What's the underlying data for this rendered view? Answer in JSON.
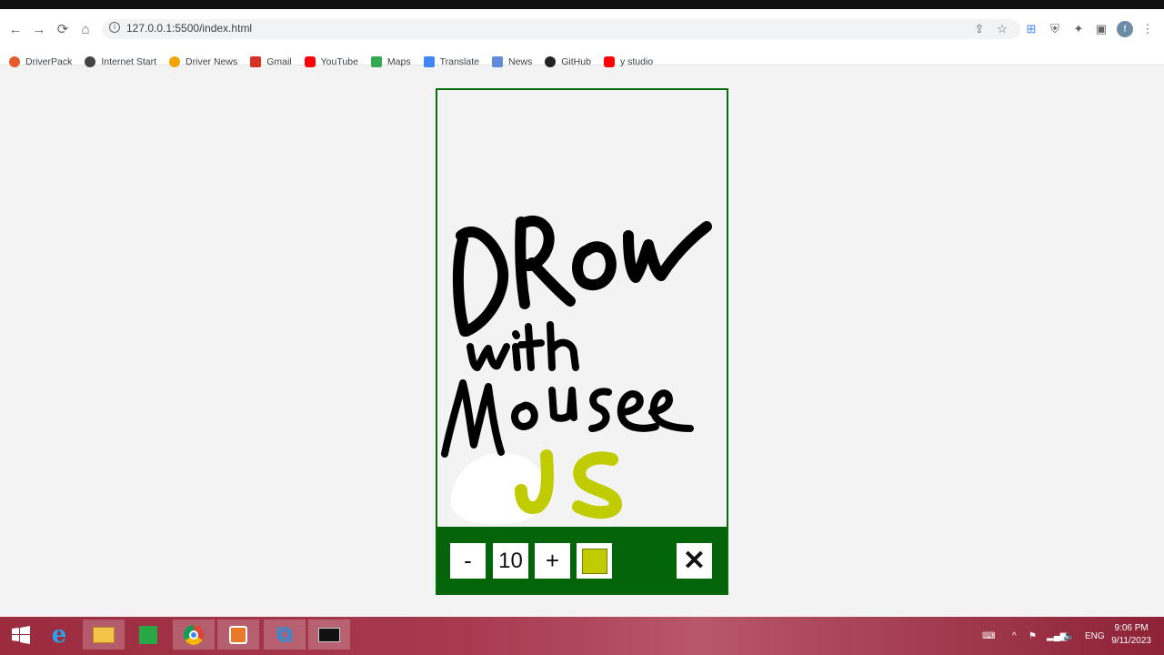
{
  "browser": {
    "url": "127.0.0.1:5500/index.html",
    "profile_initial": "f",
    "bookmarks": [
      {
        "label": "DriverPack",
        "color": "#e35b2c"
      },
      {
        "label": "Internet Start",
        "color": "#444444"
      },
      {
        "label": "Driver News",
        "color": "#f0a500"
      },
      {
        "label": "Gmail",
        "color": "#d93025"
      },
      {
        "label": "YouTube",
        "color": "#ff0000"
      },
      {
        "label": "Maps",
        "color": "#34a853"
      },
      {
        "label": "Translate",
        "color": "#4285f4"
      },
      {
        "label": "News",
        "color": "#5f8bd8"
      },
      {
        "label": "GitHub",
        "color": "#222222"
      },
      {
        "label": "y studio",
        "color": "#ff0000"
      }
    ]
  },
  "app": {
    "brush_size": "10",
    "decrease_label": "-",
    "increase_label": "+",
    "clear_label": "✕",
    "brush_color": "#c1cc00",
    "toolbar_color": "#036409",
    "border_color": "#0a6b0a"
  },
  "taskbar": {
    "language": "ENG",
    "time": "9:06 PM",
    "date": "9/11/2023"
  }
}
